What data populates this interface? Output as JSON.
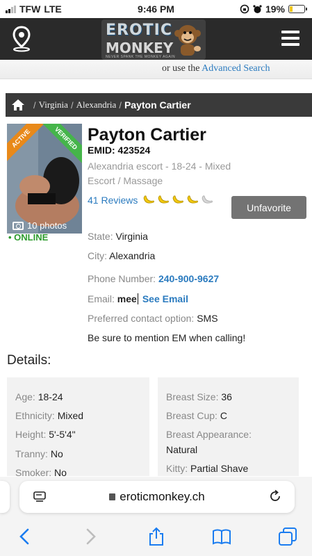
{
  "status_bar": {
    "carrier": "TFW",
    "network": "LTE",
    "time": "9:46 PM",
    "battery_percent": "19%",
    "battery_level": 0.19
  },
  "header": {
    "logo_line1": "EROTIC",
    "logo_line2": "MONKEY",
    "logo_tagline": "NEVER SPANK THE MONKEY AGAIN",
    "advanced_prefix": "or use the",
    "advanced_link": "Advanced Search"
  },
  "breadcrumb": {
    "items": [
      "Virginia",
      "Alexandria"
    ],
    "current": "Payton Cartier"
  },
  "profile": {
    "badge_active": "ACTIVE",
    "badge_verified": "VERIFIED",
    "photo_count": "10 photos",
    "online": "ONLINE",
    "name": "Payton Cartier",
    "emid": "EMID: 423524",
    "description": "Alexandria escort - 18-24 - Mixed Escort / Massage",
    "reviews": "41 Reviews",
    "rating": 4,
    "rating_max": 5,
    "unfavorite_label": "Unfavorite"
  },
  "info": {
    "state_k": "State:",
    "state_v": "Virginia",
    "city_k": "City:",
    "city_v": "Alexandria",
    "phone_k": "Phone Number:",
    "phone_v": "240-900-9627",
    "email_k": "Email:",
    "email_v": "mee",
    "email_link": "See Email",
    "contact_k": "Preferred contact option:",
    "contact_v": "SMS",
    "mention": "Be sure to mention EM when calling!"
  },
  "details": {
    "title": "Details:",
    "left": [
      {
        "k": "Age:",
        "v": "18-24"
      },
      {
        "k": "Ethnicity:",
        "v": "Mixed"
      },
      {
        "k": "Height:",
        "v": "5'-5'4\""
      },
      {
        "k": "Tranny:",
        "v": "No"
      },
      {
        "k": "Smoker:",
        "v": "No"
      }
    ],
    "right": [
      {
        "k": "Breast Size:",
        "v": "36"
      },
      {
        "k": "Breast Cup:",
        "v": "C"
      },
      {
        "k": "Breast Appearance:",
        "v": "Natural"
      },
      {
        "k": "Kitty:",
        "v": "Partial Shave"
      }
    ]
  },
  "browser": {
    "url": "eroticmonkey.ch"
  },
  "colors": {
    "accent_blue": "#2b7bbf",
    "online_green": "#2e9b2e",
    "banana": "#f2c80f"
  }
}
